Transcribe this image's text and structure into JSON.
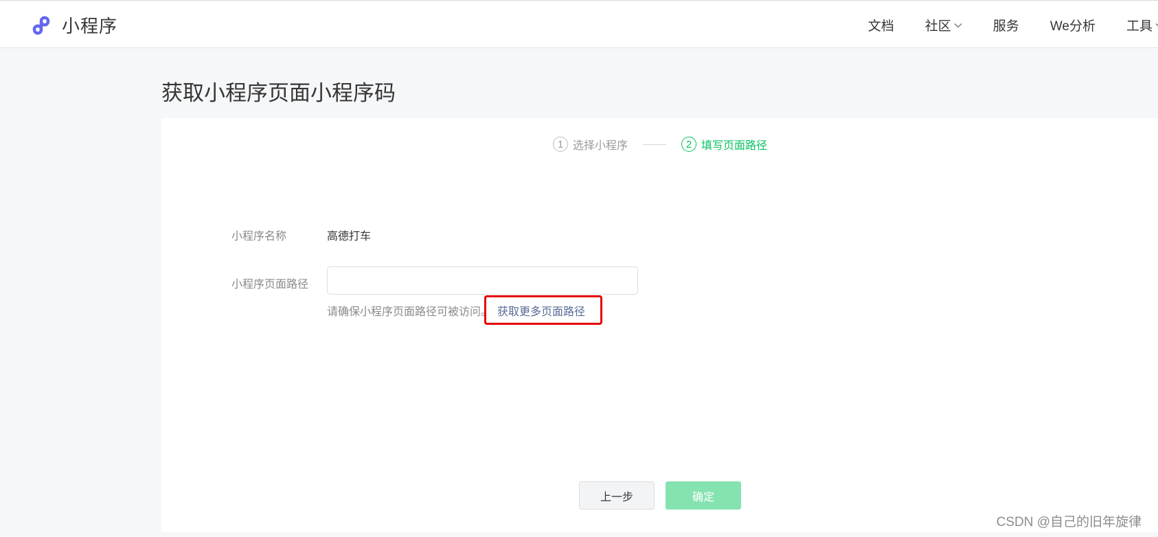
{
  "header": {
    "brand_name": "小程序",
    "brand_icon": "mini-program-logo-icon",
    "nav": [
      {
        "label": "文档",
        "has_dropdown": false
      },
      {
        "label": "社区",
        "has_dropdown": true
      },
      {
        "label": "服务",
        "has_dropdown": false
      },
      {
        "label": "We分析",
        "has_dropdown": false
      },
      {
        "label": "工具",
        "has_dropdown": true
      }
    ]
  },
  "page": {
    "title": "获取小程序页面小程序码"
  },
  "steps": [
    {
      "number": "1",
      "label": "选择小程序",
      "state": "done"
    },
    {
      "number": "2",
      "label": "填写页面路径",
      "state": "active"
    }
  ],
  "form": {
    "name_label": "小程序名称",
    "name_value": "高德打车",
    "path_label": "小程序页面路径",
    "path_value": "",
    "path_placeholder": "",
    "hint_text": "请确保小程序页面路径可被访问。",
    "hint_link": "获取更多页面路径"
  },
  "buttons": {
    "prev_label": "上一步",
    "confirm_label": "确定",
    "confirm_disabled": true
  },
  "watermark": "CSDN @自己的旧年旋律",
  "colors": {
    "brand": "#6467f0",
    "accent_green": "#07c160",
    "confirm_disabled_bg": "#85e3b1",
    "link": "#576b95",
    "highlight": "#e50000",
    "page_bg": "#f6f7f9"
  }
}
